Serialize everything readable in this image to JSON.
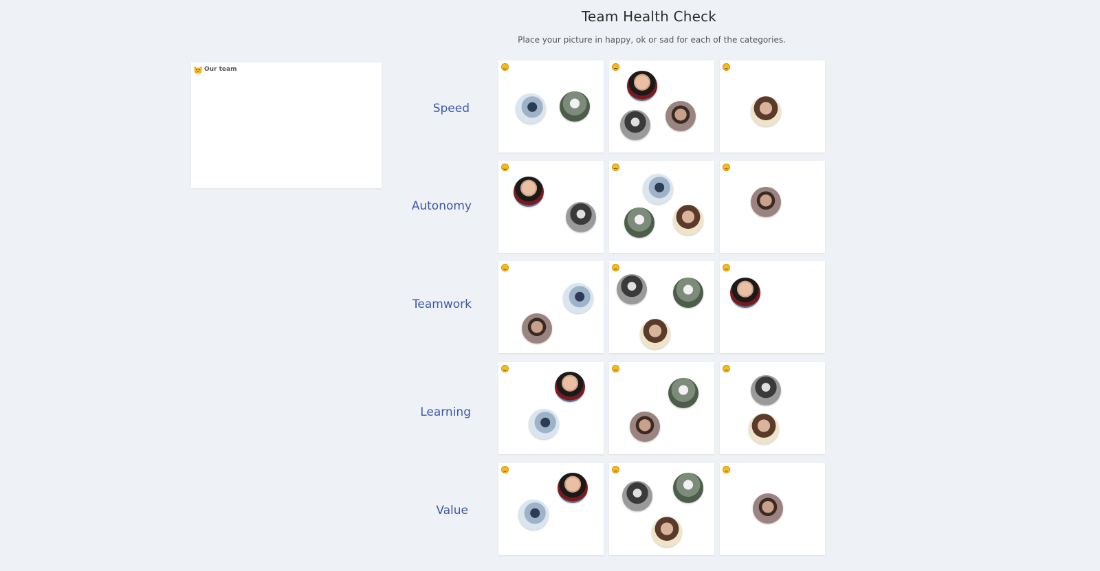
{
  "header": {
    "title": "Team Health Check",
    "subtitle": "Place your picture in happy, ok or sad for each of the categories."
  },
  "team_panel": {
    "label": "Our team",
    "icon": "cat-face-icon"
  },
  "moods": [
    "happy",
    "ok",
    "sad"
  ],
  "categories": [
    {
      "label": "Speed"
    },
    {
      "label": "Autonomy"
    },
    {
      "label": "Teamwork"
    },
    {
      "label": "Learning"
    },
    {
      "label": "Value"
    }
  ],
  "colors": {
    "background": "#eef1f5",
    "label": "#3e57a8",
    "emoji": "#f5b921"
  }
}
